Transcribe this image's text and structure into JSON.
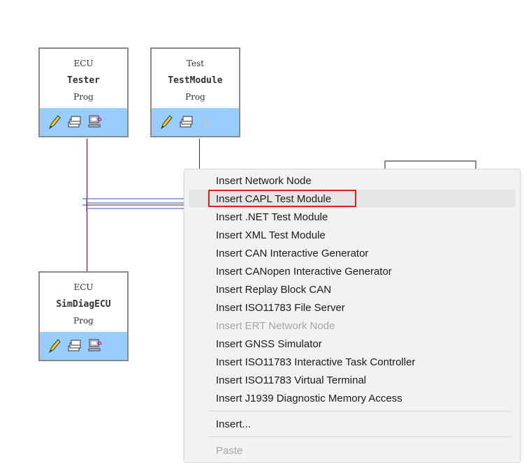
{
  "nodes": [
    {
      "id": "tester",
      "type": "ECU",
      "name": "Tester",
      "prog": "Prog",
      "icons": [
        "pencil-icon",
        "stack-icon",
        "network-icon"
      ]
    },
    {
      "id": "testmodule",
      "type": "Test",
      "name": "TestModule",
      "prog": "Prog",
      "icons": [
        "pencil-icon",
        "stack-icon",
        "play-icon"
      ]
    },
    {
      "id": "simdiag",
      "type": "ECU",
      "name": "SimDiagECU",
      "prog": "Prog",
      "icons": [
        "pencil-icon",
        "stack-icon",
        "network-icon"
      ]
    }
  ],
  "context_menu": {
    "items": [
      {
        "label": "Insert Network Node",
        "enabled": true
      },
      {
        "label": "Insert CAPL Test Module",
        "enabled": true,
        "hovered": true,
        "highlighted": true
      },
      {
        "label": "Insert .NET Test Module",
        "enabled": true
      },
      {
        "label": "Insert XML Test Module",
        "enabled": true
      },
      {
        "label": "Insert CAN Interactive Generator",
        "enabled": true
      },
      {
        "label": "Insert CANopen Interactive Generator",
        "enabled": true
      },
      {
        "label": "Insert Replay Block CAN",
        "enabled": true
      },
      {
        "label": "Insert ISO11783 File Server",
        "enabled": true
      },
      {
        "label": "Insert ERT Network Node",
        "enabled": false
      },
      {
        "label": "Insert GNSS Simulator",
        "enabled": true
      },
      {
        "label": "Insert ISO11783 Interactive Task Controller",
        "enabled": true
      },
      {
        "label": "Insert ISO11783 Virtual Terminal",
        "enabled": true
      },
      {
        "label": "Insert J1939 Diagnostic Memory Access",
        "enabled": true
      }
    ],
    "insert_label": "Insert...",
    "paste_label": "Paste",
    "highlight_color": "#e02020",
    "hover_color": "#e6e6e6"
  },
  "colors": {
    "node_bar": "#99ccff",
    "wire": "#800040",
    "bus_blue": "#3050c0"
  }
}
